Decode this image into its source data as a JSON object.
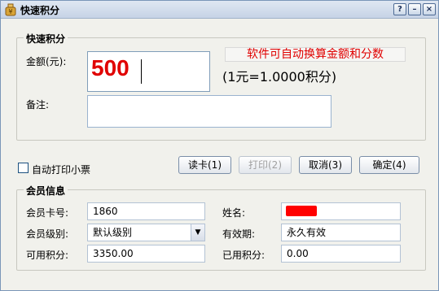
{
  "window": {
    "title": "快速积分",
    "help_glyph": "?",
    "min_glyph": "–",
    "close_glyph": "×"
  },
  "quick_points": {
    "legend": "快速积分",
    "amount_label": "金额(元):",
    "amount_value": "500",
    "hint": "软件可自动换算金额和分数",
    "rate": "(1元=1.0000积分)",
    "remark_label": "备注:",
    "remark_value": ""
  },
  "actions": {
    "auto_print_label": "自动打印小票",
    "auto_print_checked": false,
    "read_card": "读卡(1)",
    "print": "打印(2)",
    "cancel": "取消(3)",
    "confirm": "确定(4)"
  },
  "member": {
    "legend": "会员信息",
    "card_label": "会员卡号:",
    "card_value": "1860",
    "name_label": "姓名:",
    "level_label": "会员级别:",
    "level_value": "默认级别",
    "validity_label": "有效期:",
    "validity_value": "永久有效",
    "available_label": "可用积分:",
    "available_value": "3350.00",
    "used_label": "已用积分:",
    "used_value": "0.00"
  },
  "colors": {
    "accent_red": "#e00000",
    "redaction": "#ff0000"
  },
  "icons": {
    "app": "money-bag-icon",
    "dropdown": "chevron-down-icon"
  }
}
